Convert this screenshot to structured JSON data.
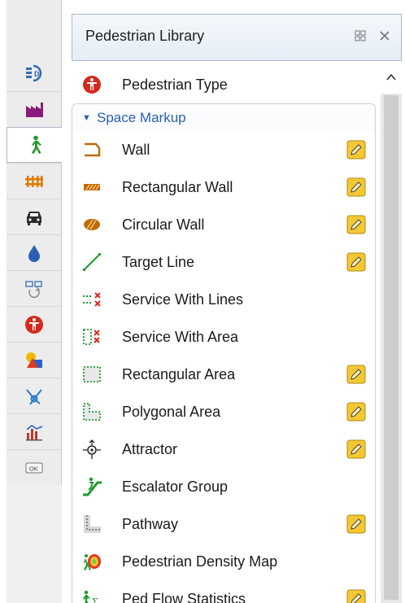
{
  "panel": {
    "title": "Pedestrian Library",
    "icons": [
      "maximize-icon",
      "close-icon"
    ]
  },
  "strip": {
    "buttons": [
      {
        "name": "process-modeling-icon",
        "active": false
      },
      {
        "name": "factory-icon",
        "active": false
      },
      {
        "name": "pedestrian-icon",
        "active": true
      },
      {
        "name": "rail-icon",
        "active": false
      },
      {
        "name": "car-icon",
        "active": false
      },
      {
        "name": "fluid-drop-icon",
        "active": false
      },
      {
        "name": "agent-flow-icon",
        "active": false
      },
      {
        "name": "pedestrian-red-icon",
        "active": false
      },
      {
        "name": "presentation-shapes-icon",
        "active": false
      },
      {
        "name": "network-icon",
        "active": false
      },
      {
        "name": "analysis-chart-icon",
        "active": false
      },
      {
        "name": "controls-ok-icon",
        "active": false
      }
    ]
  },
  "top_item": {
    "label": "Pedestrian Type",
    "icon": "pedestrian-type-icon"
  },
  "section": {
    "title": "Space Markup",
    "expanded": true
  },
  "items": [
    {
      "label": "Wall",
      "icon": "wall-icon",
      "editable": true
    },
    {
      "label": "Rectangular Wall",
      "icon": "rectangular-wall-icon",
      "editable": true
    },
    {
      "label": "Circular Wall",
      "icon": "circular-wall-icon",
      "editable": true
    },
    {
      "label": "Target Line",
      "icon": "target-line-icon",
      "editable": true
    },
    {
      "label": "Service With Lines",
      "icon": "service-lines-icon",
      "editable": false
    },
    {
      "label": "Service With Area",
      "icon": "service-area-icon",
      "editable": false
    },
    {
      "label": "Rectangular Area",
      "icon": "rectangular-area-icon",
      "editable": true
    },
    {
      "label": "Polygonal Area",
      "icon": "polygonal-area-icon",
      "editable": true
    },
    {
      "label": "Attractor",
      "icon": "attractor-icon",
      "editable": true
    },
    {
      "label": "Escalator Group",
      "icon": "escalator-icon",
      "editable": false
    },
    {
      "label": "Pathway",
      "icon": "pathway-icon",
      "editable": true
    },
    {
      "label": "Pedestrian Density Map",
      "icon": "density-map-icon",
      "editable": false
    },
    {
      "label": "Ped Flow Statistics",
      "icon": "flow-statistics-icon",
      "editable": true
    }
  ],
  "colors": {
    "accent": "#2b5fb0",
    "wall": "#c06a00",
    "pencil": "#f2c230"
  }
}
